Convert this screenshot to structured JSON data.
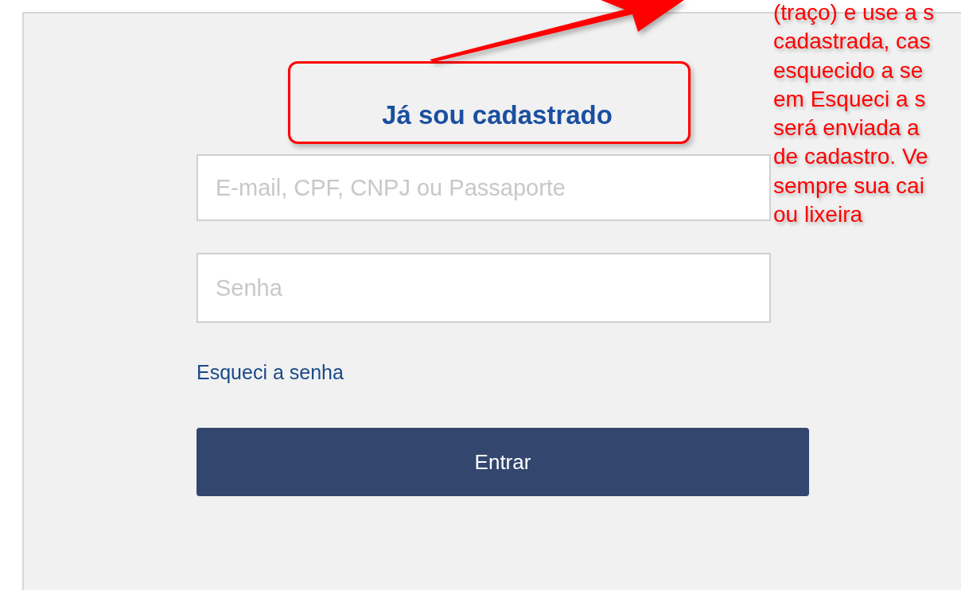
{
  "login_panel": {
    "title": "Já sou cadastrado",
    "fields": [
      {
        "placeholder": "E-mail, CPF, CNPJ ou Passaporte"
      },
      {
        "placeholder": "Senha"
      }
    ],
    "forgot_link": "Esqueci a senha",
    "submit_button": "Entrar"
  },
  "annotation": {
    "lines": [
      "(traço) e use a s",
      "cadastrada, cas",
      "esquecido a se",
      "em Esqueci a s",
      "será enviada a",
      "de cadastro. Ve",
      "sempre sua cai",
      "ou lixeira"
    ]
  }
}
